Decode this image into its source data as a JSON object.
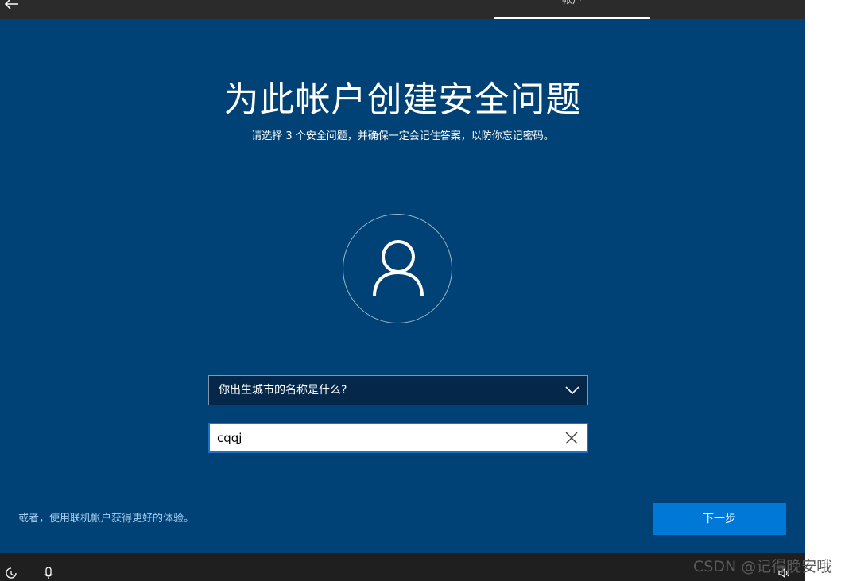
{
  "topbar": {
    "active_tab": "帐户"
  },
  "main": {
    "title": "为此帐户创建安全问题",
    "subtitle": "请选择 3 个安全问题，并确保一定会记住答案，以防你忘记密码。",
    "question_select": {
      "selected": "你出生城市的名称是什么?"
    },
    "answer_input": {
      "value": "cqqj",
      "placeholder": ""
    },
    "online_link": "或者，使用联机帐户获得更好的体验。",
    "next_button": "下一步"
  },
  "watermark": "CSDN @记得晚安哦",
  "colors": {
    "panel_blue": "#004275",
    "accent_blue": "#0078d7",
    "link_blue": "#a8d0f5",
    "topbar": "#2b2b2b",
    "taskbar": "#1f1f1f"
  },
  "icons": {
    "back": "back-arrow-icon",
    "avatar": "user-icon",
    "dropdown": "chevron-down-icon",
    "clear": "close-icon",
    "ease_of_access": "ease-of-access-icon",
    "microphone": "microphone-icon",
    "volume": "volume-icon"
  }
}
